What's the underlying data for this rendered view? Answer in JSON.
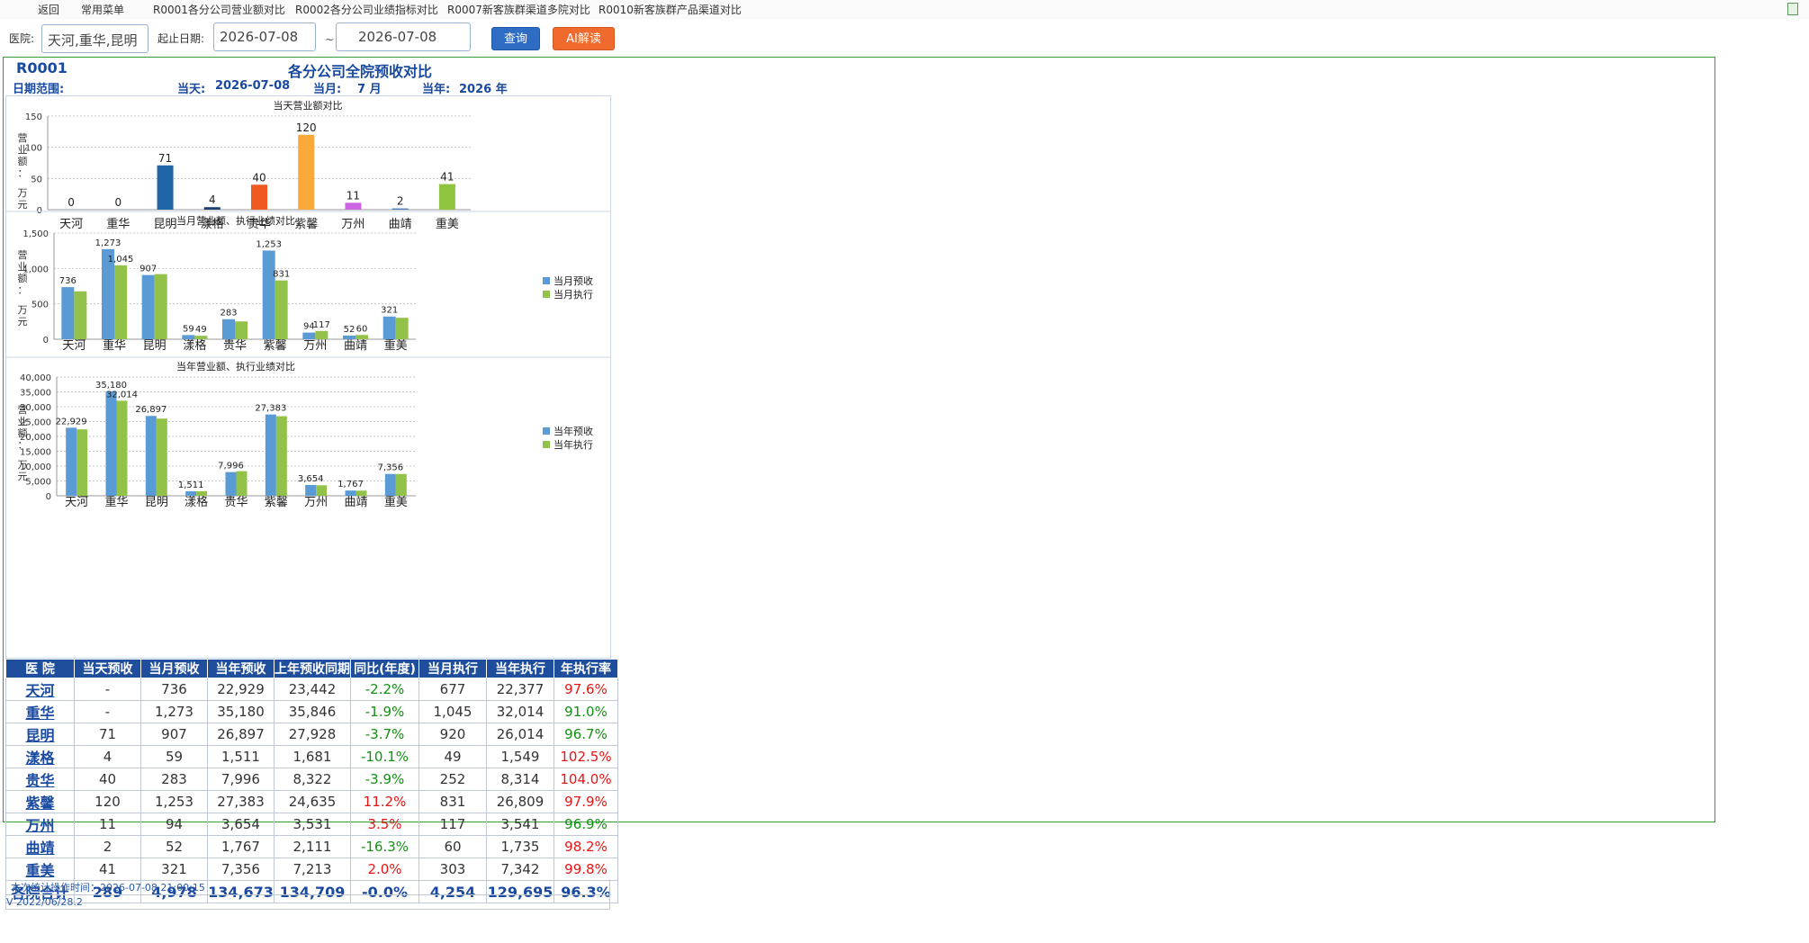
{
  "menubar": {
    "items": [
      "返回",
      "常用菜单",
      "R0001各分公司营业额对比",
      "R0002各分公司业绩指标对比",
      "R0007新客族群渠道多院对比",
      "R0010新客族群产品渠道对比"
    ],
    "right_icon": "excel-icon"
  },
  "filters": {
    "hospital_label": "医院:",
    "hospital_value": "天河,重华,昆明",
    "date_label": "起止日期:",
    "date_start": "2026-07-08",
    "date_sep": "~",
    "date_end": "2026-07-08",
    "query_button": "查询",
    "ai_button": "AI解读"
  },
  "report": {
    "code": "R0001",
    "title": "各分公司全院预收对比",
    "date_range_label": "日期范围:",
    "today_label": "当天:",
    "today_value": "2026-07-08",
    "month_label": "当月:",
    "month_value": "7 月",
    "year_label": "当年:",
    "year_value": "2026 年"
  },
  "colors": {
    "accent": "#1f4e9c",
    "query_button": "#2f6dc4",
    "ai_button": "#f06a2d",
    "frame": "#3a9a3a",
    "series_blue": "#5b9bd5",
    "series_green": "#92c24a",
    "negative": "#139013",
    "positive": "#e81414"
  },
  "chart_data": [
    {
      "type": "bar",
      "title": "当天营业额对比",
      "ylabel": "营业额：万元",
      "ylim": [
        0,
        150
      ],
      "yticks": [
        "0",
        "50",
        "100",
        "150"
      ],
      "categories": [
        "天河",
        "重华",
        "昆明",
        "漾格",
        "贵华",
        "紫馨",
        "万州",
        "曲靖",
        "重美"
      ],
      "values": [
        0,
        0,
        71,
        4,
        40,
        120,
        11,
        2,
        41
      ],
      "bar_colors": [
        "#5b9bd5",
        "#5b9bd5",
        "#1f65a8",
        "#1a3e70",
        "#f05a22",
        "#f9a93a",
        "#cc66e0",
        "#4a7fc0",
        "#8fc43e"
      ],
      "grid": true
    },
    {
      "type": "bar",
      "title": "当月营业额、执行业绩对比",
      "ylabel": "营业额：万元",
      "ylim": [
        0,
        1500
      ],
      "yticks": [
        "0",
        "500",
        "1,000",
        "1,500"
      ],
      "categories": [
        "天河",
        "重华",
        "昆明",
        "漾格",
        "贵华",
        "紫馨",
        "万州",
        "曲靖",
        "重美"
      ],
      "series": [
        {
          "name": "当月预收",
          "values": [
            736,
            1273,
            907,
            59,
            283,
            1253,
            94,
            52,
            321
          ],
          "labels": [
            "736",
            "1,273",
            "907",
            "59",
            "283",
            "1,253",
            "94",
            "52",
            "321"
          ]
        },
        {
          "name": "当月执行",
          "values": [
            677,
            1045,
            920,
            49,
            252,
            831,
            117,
            60,
            303
          ],
          "labels": [
            "",
            "1,045",
            "",
            "49",
            "",
            "831",
            "117",
            "60",
            ""
          ]
        }
      ],
      "legend": "right",
      "grid": true
    },
    {
      "type": "bar",
      "title": "当年营业额、执行业绩对比",
      "ylabel": "营业额：万元",
      "ylim": [
        0,
        40000
      ],
      "yticks": [
        "0",
        "5,000",
        "10,000",
        "15,000",
        "20,000",
        "25,000",
        "30,000",
        "35,000",
        "40,000"
      ],
      "categories": [
        "天河",
        "重华",
        "昆明",
        "漾格",
        "贵华",
        "紫馨",
        "万州",
        "曲靖",
        "重美"
      ],
      "series": [
        {
          "name": "当年预收",
          "values": [
            22929,
            35180,
            26897,
            1511,
            7996,
            27383,
            3654,
            1767,
            7356
          ],
          "labels": [
            "22,929",
            "35,180",
            "26,897",
            "1,511",
            "7,996",
            "27,383",
            "3,654",
            "1,767",
            "7,356"
          ]
        },
        {
          "name": "当年执行",
          "values": [
            22377,
            32014,
            26014,
            1549,
            8314,
            26809,
            3541,
            1735,
            7342
          ],
          "labels": [
            "",
            "32,014",
            "",
            "",
            "",
            "",
            "",
            "",
            ""
          ]
        }
      ],
      "legend": "right",
      "grid": true
    }
  ],
  "table": {
    "headers": [
      "医 院",
      "当天预收",
      "当月预收",
      "当年预收",
      "上年预收同期",
      "同比(年度)",
      "当月执行",
      "当年执行",
      "年执行率"
    ],
    "rows": [
      [
        "天河",
        "-",
        "736",
        "22,929",
        "23,442",
        "-2.2%",
        "677",
        "22,377",
        "97.6%"
      ],
      [
        "重华",
        "-",
        "1,273",
        "35,180",
        "35,846",
        "-1.9%",
        "1,045",
        "32,014",
        "91.0%"
      ],
      [
        "昆明",
        "71",
        "907",
        "26,897",
        "27,928",
        "-3.7%",
        "920",
        "26,014",
        "96.7%"
      ],
      [
        "漾格",
        "4",
        "59",
        "1,511",
        "1,681",
        "-10.1%",
        "49",
        "1,549",
        "102.5%"
      ],
      [
        "贵华",
        "40",
        "283",
        "7,996",
        "8,322",
        "-3.9%",
        "252",
        "8,314",
        "104.0%"
      ],
      [
        "紫馨",
        "120",
        "1,253",
        "27,383",
        "24,635",
        "11.2%",
        "831",
        "26,809",
        "97.9%"
      ],
      [
        "万州",
        "11",
        "94",
        "3,654",
        "3,531",
        "3.5%",
        "117",
        "3,541",
        "96.9%"
      ],
      [
        "曲靖",
        "2",
        "52",
        "1,767",
        "2,111",
        "-16.3%",
        "60",
        "1,735",
        "98.2%"
      ],
      [
        "重美",
        "41",
        "321",
        "7,356",
        "7,213",
        "2.0%",
        "303",
        "7,342",
        "99.8%"
      ]
    ],
    "total": [
      "各院合计",
      "289",
      "4,978",
      "134,673",
      "134,709",
      "-0.0%",
      "4,254",
      "129,695",
      "96.3%"
    ]
  },
  "footer": {
    "stat_time": "本次统计操作时间：2026-07-08  21:00:15",
    "version": "V  2022/06/28.2"
  }
}
